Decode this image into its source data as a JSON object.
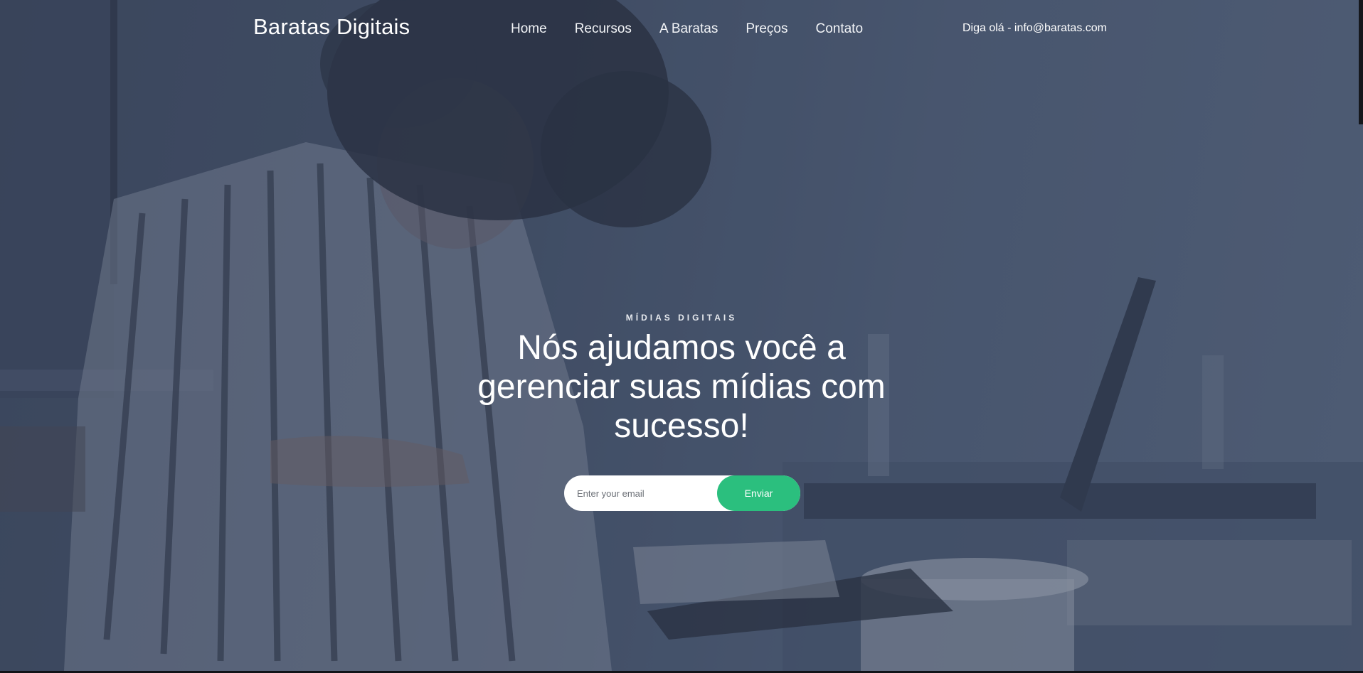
{
  "header": {
    "logo": "Baratas Digitais",
    "nav": [
      {
        "label": "Home"
      },
      {
        "label": "Recursos"
      },
      {
        "label": "A Baratas"
      },
      {
        "label": "Preços"
      },
      {
        "label": "Contato"
      }
    ],
    "contact": "Diga olá - info@baratas.com"
  },
  "hero": {
    "eyebrow": "MÍDIAS DIGITAIS",
    "headline": "Nós ajudamos você a gerenciar suas mídias com sucesso!",
    "email_placeholder": "Enter your email",
    "submit_label": "Enviar",
    "background_icon": "photo-person-laptop-desk"
  },
  "colors": {
    "overlay": "#3f4b60",
    "accent": "#2bbf7e",
    "text": "#ffffff"
  }
}
